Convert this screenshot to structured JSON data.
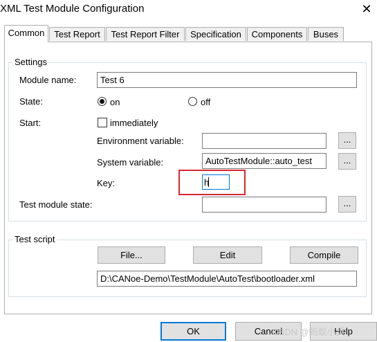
{
  "window": {
    "title": "XML Test Module Configuration",
    "close_glyph": "✕"
  },
  "tabs": [
    {
      "label": "Common",
      "active": true
    },
    {
      "label": "Test Report"
    },
    {
      "label": "Test Report Filter"
    },
    {
      "label": "Specification"
    },
    {
      "label": "Components"
    },
    {
      "label": "Buses"
    }
  ],
  "settings": {
    "legend": "Settings",
    "module_name_label": "Module name:",
    "module_name_value": "Test 6",
    "state_label": "State:",
    "state_on": "on",
    "state_off": "off",
    "start_label": "Start:",
    "immediately_label": "immediately",
    "env_var_label": "Environment variable:",
    "env_var_value": "",
    "sys_var_label": "System variable:",
    "sys_var_value": "AutoTestModule::auto_test",
    "key_label": "Key:",
    "key_value": "h",
    "tm_state_label": "Test module state:",
    "tm_state_value": "",
    "browse_label": "..."
  },
  "script": {
    "legend": "Test script",
    "file_label": "File...",
    "edit_label": "Edit",
    "compile_label": "Compile",
    "path_value": "D:\\CANoe-Demo\\TestModule\\AutoTest\\bootloader.xml"
  },
  "footer": {
    "ok_label": "OK",
    "cancel_label": "Cancel",
    "help_label": "Help",
    "watermark": "CSDN @蚂蚁小兵"
  },
  "colors": {
    "highlight_box": "#d9262e",
    "focus_border": "#0078d7"
  }
}
